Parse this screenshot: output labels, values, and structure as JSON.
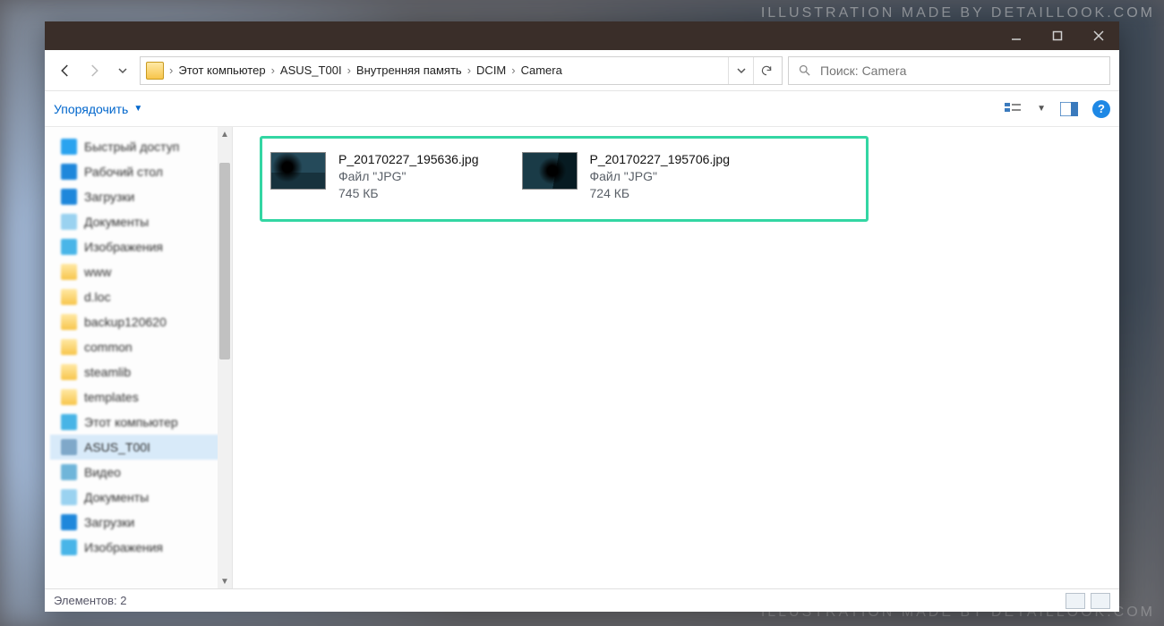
{
  "watermark": "ILLUSTRATION MADE BY DETAILLOOK.COM",
  "breadcrumb": {
    "items": [
      "Этот компьютер",
      "ASUS_T00I",
      "Внутренняя память",
      "DCIM",
      "Camera"
    ]
  },
  "search": {
    "placeholder": "Поиск: Camera"
  },
  "organize": {
    "label": "Упорядочить"
  },
  "help": {
    "symbol": "?"
  },
  "nav": {
    "items": [
      {
        "label": "Быстрый доступ",
        "icon": "star"
      },
      {
        "label": "Рабочий стол",
        "icon": "desk"
      },
      {
        "label": "Загрузки",
        "icon": "dl"
      },
      {
        "label": "Документы",
        "icon": "doc"
      },
      {
        "label": "Изображения",
        "icon": "img"
      },
      {
        "label": "www",
        "icon": "folder"
      },
      {
        "label": "d.loc",
        "icon": "folder"
      },
      {
        "label": "backup120620",
        "icon": "folder"
      },
      {
        "label": "common",
        "icon": "folder"
      },
      {
        "label": "steamlib",
        "icon": "folder"
      },
      {
        "label": "templates",
        "icon": "folder"
      },
      {
        "label": "Этот компьютер",
        "icon": "pc"
      },
      {
        "label": "ASUS_T00I",
        "icon": "phone",
        "selected": true
      },
      {
        "label": "Видео",
        "icon": "video"
      },
      {
        "label": "Документы",
        "icon": "doc"
      },
      {
        "label": "Загрузки",
        "icon": "dl"
      },
      {
        "label": "Изображения",
        "icon": "img"
      }
    ]
  },
  "files": [
    {
      "name": "P_20170227_195636.jpg",
      "type": "Файл \"JPG\"",
      "size": "745 КБ"
    },
    {
      "name": "P_20170227_195706.jpg",
      "type": "Файл \"JPG\"",
      "size": "724 КБ"
    }
  ],
  "status": {
    "count_label": "Элементов: 2"
  }
}
